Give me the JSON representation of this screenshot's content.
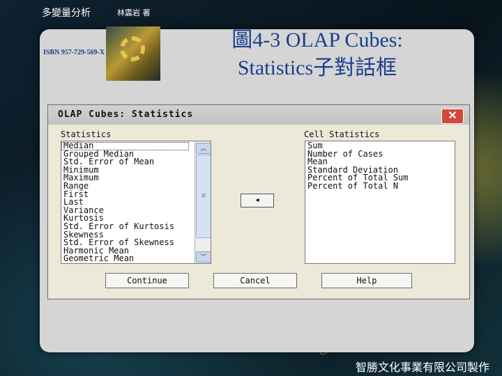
{
  "header": {
    "book_title": "多變量分析",
    "author": "林震岩 著",
    "isbn": "ISBN 957-729-569-X",
    "slide_title_line1": "圖4-3  OLAP Cubes:",
    "slide_title_line2": "Statistics子對話框",
    "footer": "智勝文化事業有限公司製作"
  },
  "dialog": {
    "title": "OLAP Cubes: Statistics",
    "close_icon": "close-icon",
    "statistics_label": "Statistics",
    "cell_statistics_label": "Cell Statistics",
    "statistics_items": [
      "Median",
      "Grouped Median",
      "Std. Error of Mean",
      "Minimum",
      "Maximum",
      "Range",
      "First",
      "Last",
      "Variance",
      "Kurtosis",
      "Std. Error of Kurtosis",
      "Skewness",
      "Std. Error of Skewness",
      "Harmonic Mean",
      "Geometric Mean"
    ],
    "cell_statistics_items": [
      "Sum",
      "Number of Cases",
      "Mean",
      "Standard Deviation",
      "Percent of Total Sum",
      "Percent of Total N"
    ],
    "move_button_glyph": "◂",
    "buttons": {
      "continue": "Continue",
      "cancel": "Cancel",
      "help": "Help"
    }
  },
  "colors": {
    "title_blue": "#1a3f8f",
    "close_red": "#d4483a"
  }
}
